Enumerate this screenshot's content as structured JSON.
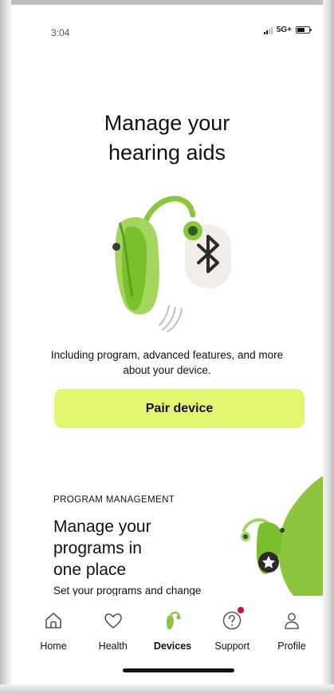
{
  "status_bar": {
    "time": "3:04",
    "network": "5G+"
  },
  "hero": {
    "title_line1": "Manage your",
    "title_line2": "hearing aids",
    "subtitle": "Including program, advanced features, and more about your device.",
    "pair_button": "Pair device",
    "image_icons": [
      "hearing-aid-icon",
      "bluetooth-icon"
    ]
  },
  "card": {
    "eyebrow": "PROGRAM MANAGEMENT",
    "title_line1": "Manage your",
    "title_line2": "programs in",
    "title_line3": "one place",
    "description": "Set your programs and change"
  },
  "tabs": [
    {
      "label": "Home",
      "icon": "home-icon",
      "active": false
    },
    {
      "label": "Health",
      "icon": "heart-icon",
      "active": false
    },
    {
      "label": "Devices",
      "icon": "hearing-aid-icon",
      "active": true
    },
    {
      "label": "Support",
      "icon": "question-icon",
      "active": false,
      "badge": true
    },
    {
      "label": "Profile",
      "icon": "person-icon",
      "active": false
    }
  ],
  "colors": {
    "accent_green": "#8cc63f",
    "button_yellow_green": "#e3f571",
    "badge_red": "#c8102e",
    "text": "#111111"
  }
}
